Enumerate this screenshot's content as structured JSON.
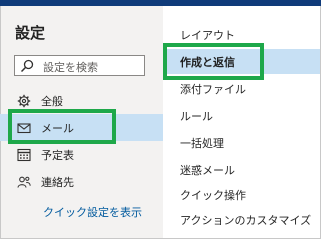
{
  "settings": {
    "title": "設定"
  },
  "search": {
    "placeholder": "設定を検索",
    "icon": "search-icon"
  },
  "nav": [
    {
      "label": "全般",
      "icon": "gear-icon",
      "selected": false
    },
    {
      "label": "メール",
      "icon": "mail-icon",
      "selected": true
    },
    {
      "label": "予定表",
      "icon": "calendar-icon",
      "selected": false
    },
    {
      "label": "連絡先",
      "icon": "people-icon",
      "selected": false
    }
  ],
  "quick_settings_link": "クイック設定を表示",
  "mail_subnav": [
    {
      "label": "レイアウト",
      "selected": false
    },
    {
      "label": "作成と返信",
      "selected": true
    },
    {
      "label": "添付ファイル",
      "selected": false
    },
    {
      "label": "ルール",
      "selected": false
    },
    {
      "label": "一括処理",
      "selected": false
    },
    {
      "label": "迷惑メール",
      "selected": false
    },
    {
      "label": "クイック操作",
      "selected": false
    },
    {
      "label": "アクションのカスタマイズ",
      "selected": false
    }
  ],
  "colors": {
    "top_bar": "#0f3b7a",
    "selected_bg": "#c7e0f4",
    "highlight": "#1ea84a",
    "link": "#005a9e"
  }
}
